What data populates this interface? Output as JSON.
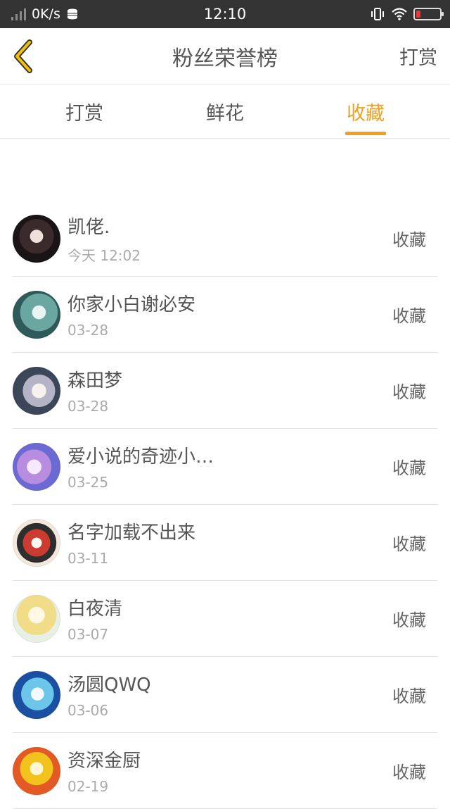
{
  "status_bar": {
    "speed": "0K/s",
    "time": "12:10",
    "icons": [
      "signal-icon",
      "database-icon",
      "vibrate-icon",
      "wifi-icon",
      "battery-low-icon"
    ]
  },
  "header": {
    "title": "粉丝荣誉榜",
    "right_action": "打赏",
    "back_icon": "chevron-left-icon",
    "accent_color": "#f0a21e"
  },
  "tabs": [
    {
      "label": "打赏",
      "active": false
    },
    {
      "label": "鲜花",
      "active": false
    },
    {
      "label": "收藏",
      "active": true
    }
  ],
  "fans": [
    {
      "name": "凯佬.",
      "date": "今天 12:02",
      "action": "收藏"
    },
    {
      "name": "你家小白谢必安",
      "date": "03-28",
      "action": "收藏"
    },
    {
      "name": "森田梦",
      "date": "03-28",
      "action": "收藏"
    },
    {
      "name": "爱小说的奇迹小…",
      "date": "03-25",
      "action": "收藏"
    },
    {
      "name": "名字加载不出来",
      "date": "03-11",
      "action": "收藏"
    },
    {
      "name": "白夜清",
      "date": "03-07",
      "action": "收藏"
    },
    {
      "name": "汤圆QWQ",
      "date": "03-06",
      "action": "收藏"
    },
    {
      "name": "资深金厨",
      "date": "02-19",
      "action": "收藏"
    }
  ]
}
